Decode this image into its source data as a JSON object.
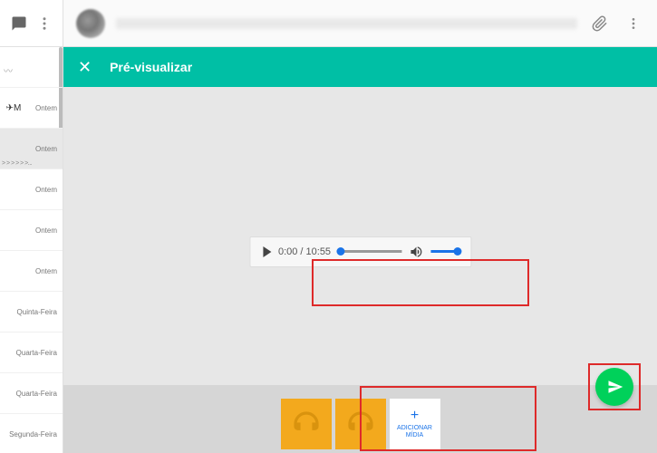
{
  "sidebar": {
    "items": [
      {
        "label": ""
      },
      {
        "label": "Ontem",
        "badge": "M"
      },
      {
        "label": "Ontem",
        "chevrons": "> > > > > >..."
      },
      {
        "label": "Ontem"
      },
      {
        "label": "Ontem"
      },
      {
        "label": "Ontem"
      },
      {
        "label": "Quinta-Feira"
      },
      {
        "label": "Quarta-Feira"
      },
      {
        "label": "Quarta-Feira"
      },
      {
        "label": "Segunda-Feira"
      }
    ]
  },
  "header": {
    "contact_name": ""
  },
  "preview": {
    "title": "Pré-visualizar"
  },
  "audio": {
    "current_time": "0:00",
    "total_time": "10:55",
    "time_display": "0:00 / 10:55"
  },
  "media_tray": {
    "add_label_line1": "ADICIONAR",
    "add_label_line2": "MÍDIA",
    "plus": "+"
  },
  "colors": {
    "accent": "#00bfa5",
    "send": "#00d15a",
    "media_thumb": "#f3a91d",
    "link_blue": "#1a73e8",
    "highlight_border": "#de2a2a"
  }
}
